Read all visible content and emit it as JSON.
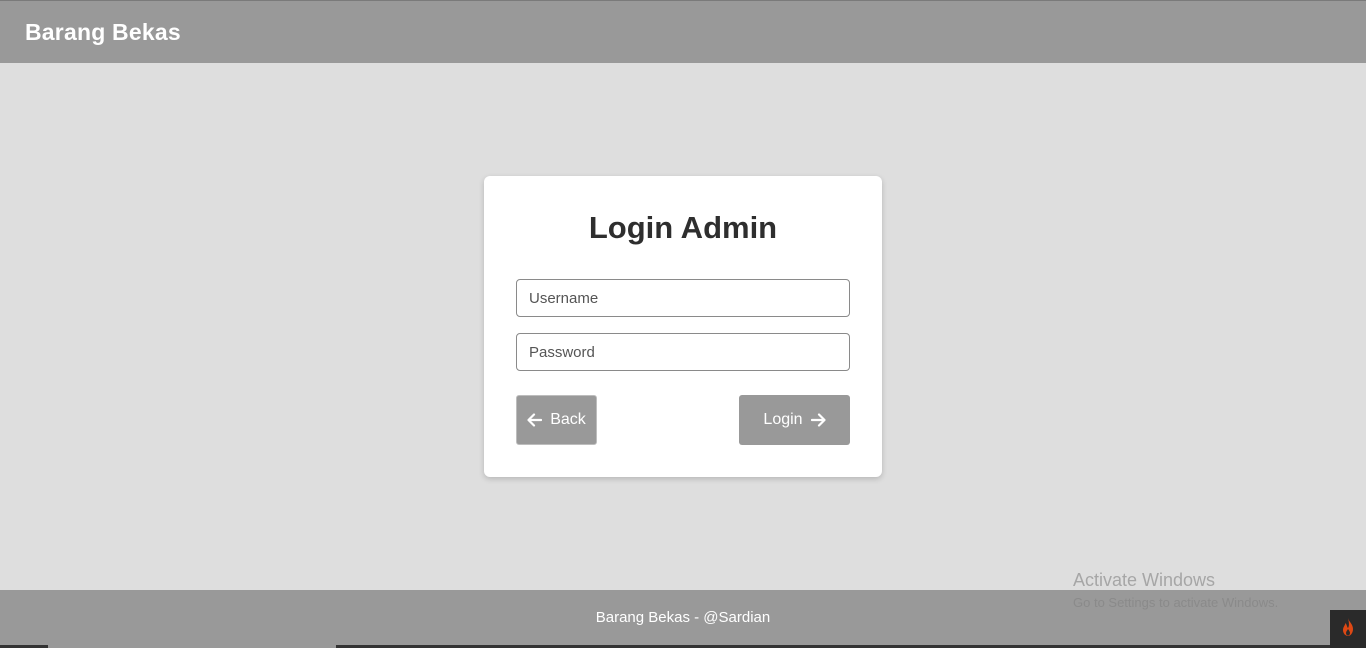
{
  "header": {
    "brand": "Barang Bekas"
  },
  "login_card": {
    "title": "Login Admin",
    "username": {
      "value": "",
      "placeholder": "Username"
    },
    "password": {
      "value": "",
      "placeholder": "Password"
    },
    "back_label": "Back",
    "login_label": "Login"
  },
  "footer": {
    "text": "Barang Bekas - @Sardian"
  },
  "watermark": {
    "title": "Activate Windows",
    "subtitle": "Go to Settings to activate Windows."
  },
  "icons": {
    "back": "arrow-left-icon",
    "login": "arrow-right-icon",
    "dev_toolbar": "flame-icon"
  },
  "colors": {
    "header_bg": "#999999",
    "page_bg": "#dedede",
    "button_bg": "#999999",
    "card_bg": "#ffffff"
  }
}
